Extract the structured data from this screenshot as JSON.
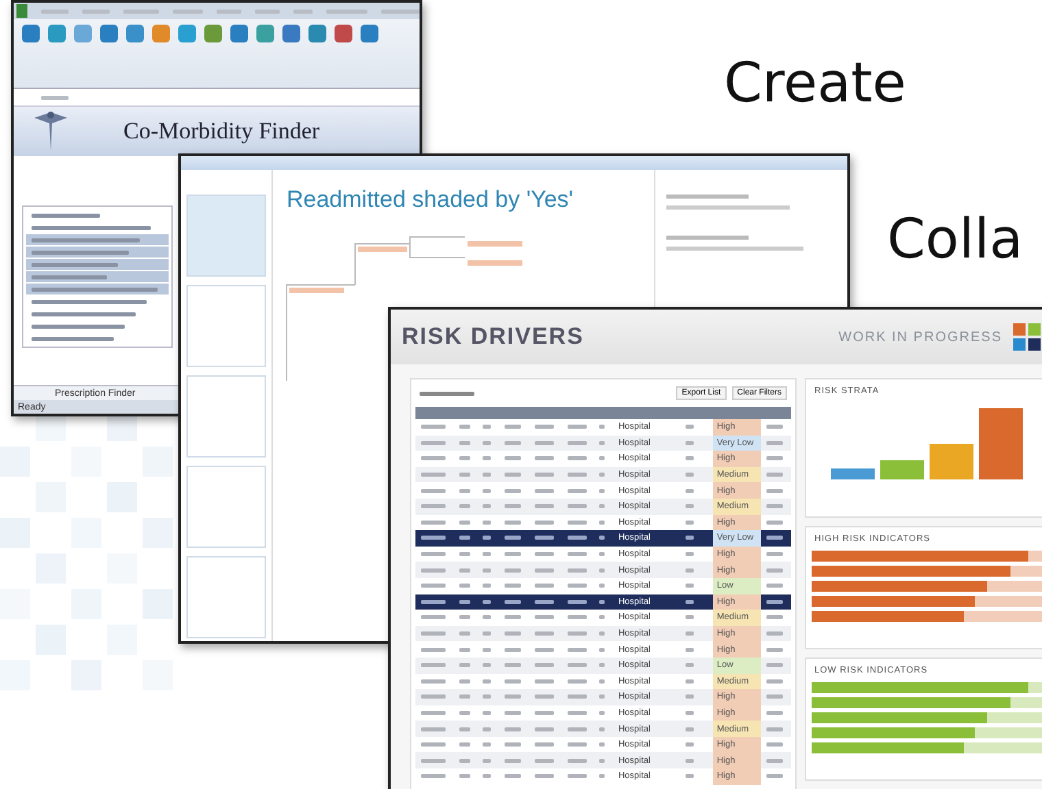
{
  "slide_words": [
    {
      "text": "Create"
    },
    {
      "text": "Colla"
    }
  ],
  "excel": {
    "app_title": "Co-Morbidity Finder",
    "diagnosis_rows": [
      {
        "selected": false
      },
      {
        "selected": false
      },
      {
        "selected": true
      },
      {
        "selected": true
      },
      {
        "selected": true
      },
      {
        "selected": true
      },
      {
        "selected": true
      },
      {
        "selected": false
      },
      {
        "selected": false
      },
      {
        "selected": false
      },
      {
        "selected": false
      }
    ],
    "sheet_tab": "Prescription Finder",
    "status": "Ready"
  },
  "model_window": {
    "heading": "Readmitted shaded by 'Yes'"
  },
  "risk_drivers": {
    "title": "RISK DRIVERS",
    "banner": "WORK IN PROGRESS",
    "buttons": [
      "Export List",
      "Clear Filters"
    ],
    "rows": [
      {
        "facility": "Hospital",
        "risk": "High",
        "color": "#f2cdb6",
        "selected": false
      },
      {
        "facility": "Hospital",
        "risk": "Very Low",
        "color": "#cfe3f4",
        "selected": false
      },
      {
        "facility": "Hospital",
        "risk": "High",
        "color": "#f2cdb6",
        "selected": false
      },
      {
        "facility": "Hospital",
        "risk": "Medium",
        "color": "#f6e4b2",
        "selected": false
      },
      {
        "facility": "Hospital",
        "risk": "High",
        "color": "#f2cdb6",
        "selected": false
      },
      {
        "facility": "Hospital",
        "risk": "Medium",
        "color": "#f6e4b2",
        "selected": false
      },
      {
        "facility": "Hospital",
        "risk": "High",
        "color": "#f2cdb6",
        "selected": false
      },
      {
        "facility": "Hospital",
        "risk": "Very Low",
        "color": "#cfe3f4",
        "selected": true
      },
      {
        "facility": "Hospital",
        "risk": "High",
        "color": "#f2cdb6",
        "selected": false
      },
      {
        "facility": "Hospital",
        "risk": "High",
        "color": "#f2cdb6",
        "selected": false
      },
      {
        "facility": "Hospital",
        "risk": "Low",
        "color": "#dcedc4",
        "selected": false
      },
      {
        "facility": "Hospital",
        "risk": "High",
        "color": "#f2cdb6",
        "selected": true
      },
      {
        "facility": "Hospital",
        "risk": "Medium",
        "color": "#f6e4b2",
        "selected": false
      },
      {
        "facility": "Hospital",
        "risk": "High",
        "color": "#f2cdb6",
        "selected": false
      },
      {
        "facility": "Hospital",
        "risk": "High",
        "color": "#f2cdb6",
        "selected": false
      },
      {
        "facility": "Hospital",
        "risk": "Low",
        "color": "#dcedc4",
        "selected": false
      },
      {
        "facility": "Hospital",
        "risk": "Medium",
        "color": "#f6e4b2",
        "selected": false
      },
      {
        "facility": "Hospital",
        "risk": "High",
        "color": "#f2cdb6",
        "selected": false
      },
      {
        "facility": "Hospital",
        "risk": "High",
        "color": "#f2cdb6",
        "selected": false
      },
      {
        "facility": "Hospital",
        "risk": "Medium",
        "color": "#f6e4b2",
        "selected": false
      },
      {
        "facility": "Hospital",
        "risk": "High",
        "color": "#f2cdb6",
        "selected": false
      },
      {
        "facility": "Hospital",
        "risk": "High",
        "color": "#f2cdb6",
        "selected": false
      },
      {
        "facility": "Hospital",
        "risk": "High",
        "color": "#f2cdb6",
        "selected": false
      }
    ],
    "strata_title": "RISK STRATA",
    "indicator_panels": [
      {
        "title": "HIGH RISK INDICATORS",
        "color": "#d9692c",
        "bars": [
          {
            "level": 0.93
          },
          {
            "level": 0.85
          },
          {
            "level": 0.75
          },
          {
            "level": 0.7
          },
          {
            "level": 0.65
          }
        ]
      },
      {
        "title": "LOW RISK INDICATORS",
        "color": "#8bbf3a",
        "bars": [
          {
            "level": 0.93
          },
          {
            "level": 0.85
          },
          {
            "level": 0.75
          },
          {
            "level": 0.7
          },
          {
            "level": 0.65
          }
        ]
      }
    ]
  }
}
